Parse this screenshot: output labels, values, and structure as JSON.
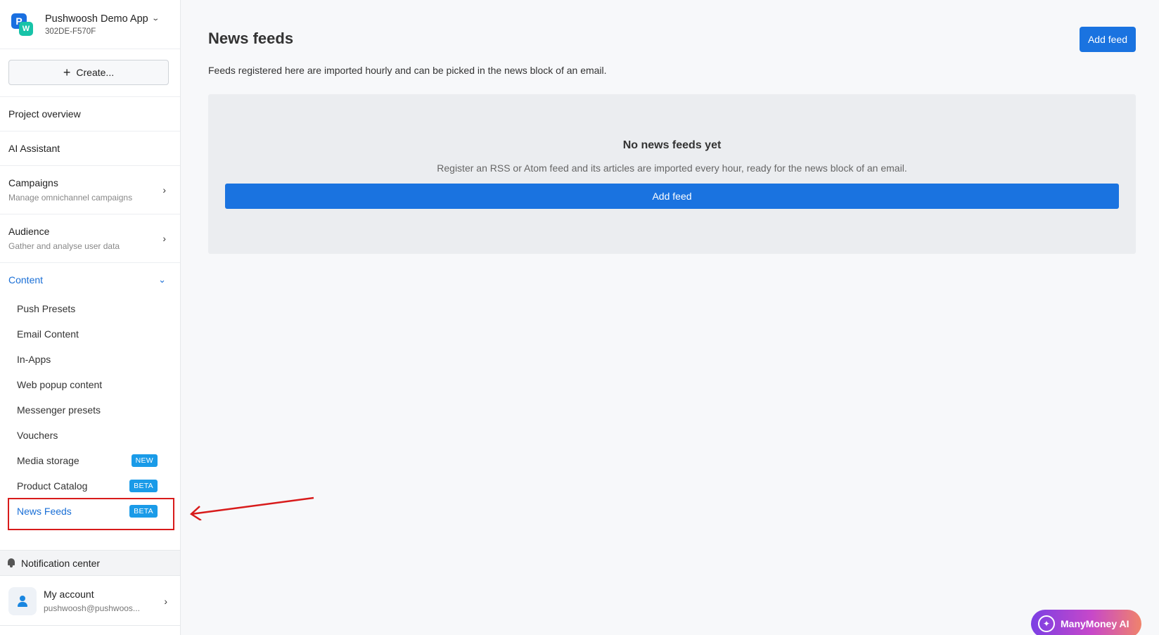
{
  "app": {
    "name": "Pushwoosh Demo App",
    "code": "302DE-F570F",
    "logo_p": "P",
    "logo_w": "W"
  },
  "sidebar": {
    "create_label": "Create...",
    "items": [
      {
        "label": "Project overview"
      },
      {
        "label": "AI Assistant"
      },
      {
        "label": "Campaigns",
        "sub": "Manage omnichannel campaigns"
      },
      {
        "label": "Audience",
        "sub": "Gather and analyse user data"
      },
      {
        "label": "Content"
      }
    ],
    "content_items": [
      {
        "label": "Push Presets"
      },
      {
        "label": "Email Content"
      },
      {
        "label": "In-Apps"
      },
      {
        "label": "Web popup content"
      },
      {
        "label": "Messenger presets"
      },
      {
        "label": "Vouchers"
      },
      {
        "label": "Media storage",
        "badge": "NEW"
      },
      {
        "label": "Product Catalog",
        "badge": "BETA"
      },
      {
        "label": "News Feeds",
        "badge": "BETA"
      }
    ],
    "notification_center": "Notification center",
    "account": {
      "name": "My account",
      "email": "pushwoosh@pushwoos..."
    }
  },
  "main": {
    "title": "News feeds",
    "add_feed_label": "Add feed",
    "description": "Feeds registered here are imported hourly and can be picked in the news block of an email.",
    "empty": {
      "title": "No news feeds yet",
      "description": "Register an RSS or Atom feed and its articles are imported every hour, ready for the news block of an email.",
      "button": "Add feed"
    }
  },
  "widget": {
    "label": "ManyMoney AI"
  },
  "colors": {
    "accent": "#1a73e0",
    "active_nav": "#1a6fd6",
    "badge": "#1a9be8",
    "highlight": "#d81b1b"
  },
  "icons": {
    "plus": "plus-icon",
    "bell": "bell-icon",
    "chevron": "chevron-right-icon",
    "user": "user-icon"
  }
}
